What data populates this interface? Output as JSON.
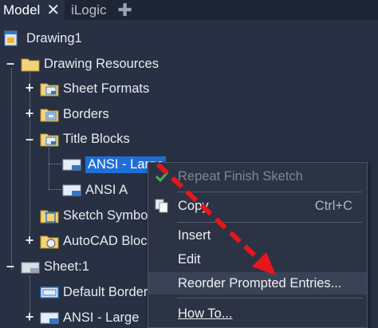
{
  "tabs": [
    {
      "label": "Model",
      "active": true
    },
    {
      "label": "iLogic",
      "active": false
    }
  ],
  "tree": {
    "root": "Drawing1",
    "drawing_resources": "Drawing Resources",
    "sheet_formats": "Sheet Formats",
    "borders": "Borders",
    "title_blocks": "Title Blocks",
    "ansi_large_tb": "ANSI - Large",
    "ansi_a": "ANSI A",
    "sketch_symbols": "Sketch Symbols",
    "autocad_blocks": "AutoCAD Blocks",
    "sheet1": "Sheet:1",
    "default_border": "Default Border",
    "ansi_large_sheet": "ANSI - Large"
  },
  "context_menu": {
    "repeat": "Repeat Finish Sketch",
    "copy": "Copy",
    "copy_shortcut": "Ctrl+C",
    "insert": "Insert",
    "edit": "Edit",
    "reorder": "Reorder Prompted Entries...",
    "how_to": "How To..."
  },
  "colors": {
    "background": "#283043",
    "selection": "#1f6fd6",
    "annotation_arrow": "#e8161b"
  }
}
